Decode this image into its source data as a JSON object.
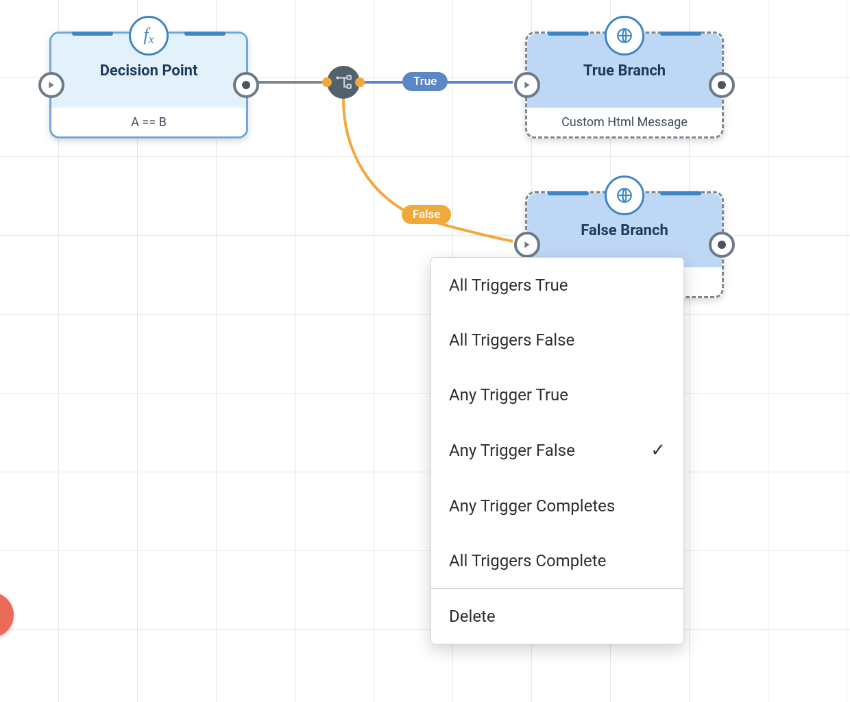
{
  "nodes": {
    "decision": {
      "title": "Decision Point",
      "subtitle": "A == B",
      "icon": "fx"
    },
    "trueBranch": {
      "title": "True Branch",
      "subtitle": "Custom Html Message",
      "icon": "globe"
    },
    "falseBranch": {
      "title": "False Branch",
      "subtitle": "",
      "icon": "globe"
    }
  },
  "edges": {
    "true": {
      "label": "True"
    },
    "false": {
      "label": "False"
    }
  },
  "menu": {
    "items": [
      {
        "label": "All Triggers True",
        "checked": false
      },
      {
        "label": "All Triggers False",
        "checked": false
      },
      {
        "label": "Any Trigger True",
        "checked": false
      },
      {
        "label": "Any Trigger False",
        "checked": true
      },
      {
        "label": "Any Trigger Completes",
        "checked": false
      },
      {
        "label": "All Triggers Complete",
        "checked": false
      }
    ],
    "delete": "Delete"
  }
}
